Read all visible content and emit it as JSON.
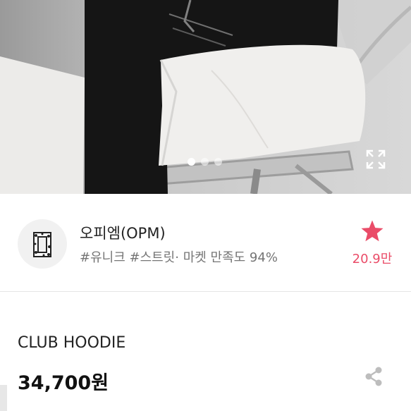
{
  "hero": {
    "slide_count": 3,
    "active_slide": 1
  },
  "store": {
    "name": "오피엠(OPM)",
    "tags": "#유니크 #스트릿· 마켓 만족도 94%",
    "favorite_count": "20.9만",
    "star_color": "#ea4c68"
  },
  "product": {
    "name": "CLUB HOODIE",
    "price": "34,700원"
  },
  "icons": {
    "expand": "expand-icon",
    "share": "share-icon",
    "star": "star-icon"
  }
}
